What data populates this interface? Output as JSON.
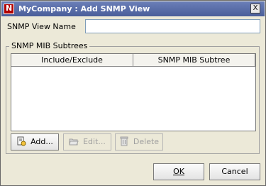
{
  "window": {
    "title": "MyCompany : Add SNMP View",
    "close_glyph": "X"
  },
  "form": {
    "view_name_label": "SNMP View Name",
    "view_name_value": ""
  },
  "subtrees": {
    "group_title": "SNMP MIB Subtrees",
    "columns": [
      "Include/Exclude",
      "SNMP MIB Subtree"
    ],
    "rows": []
  },
  "actions": {
    "add_label": "Add...",
    "edit_label": "Edit...",
    "delete_label": "Delete"
  },
  "dialog_buttons": {
    "ok_label": "OK",
    "cancel_label": "Cancel"
  },
  "icons": {
    "add": "document-add-icon",
    "edit": "folder-open-icon",
    "delete": "trash-icon"
  },
  "colors": {
    "titlebar": "#5a6ea8",
    "window_bg": "#ece9d8",
    "app_icon": "#b00000"
  }
}
